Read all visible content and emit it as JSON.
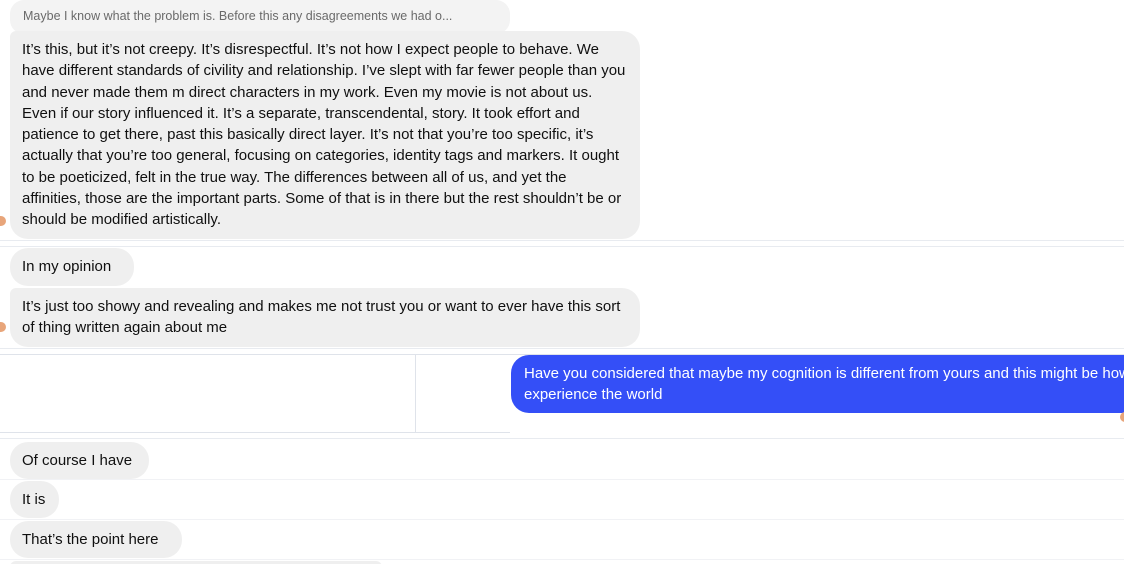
{
  "messages": {
    "reply_preview": "Maybe I know what the problem is. Before this any disagreements we had o...",
    "long_message": "It’s this, but it’s not creepy. It’s disrespectful. It’s not how I expect people to behave. We have different standards of civility and relationship. I’ve slept with far fewer people than you and never made them m direct characters in my work. Even my movie is not about us. Even if our story influenced it. It’s a separate, transcendental, story. It took effort and patience to get there, past this basically direct layer. It’s not that you’re too specific, it’s actually that you’re too general, focusing on categories, identity tags and markers. It ought to be poeticized, felt in the true way. The differences between all of us, and yet the affinities, those are the important parts. Some of that is in there but the rest shouldn’t be or should be modified artistically.",
    "opinion": "In my opinion",
    "too_showy": "It’s just too showy and revealing and makes me not trust you or want to ever have this sort of thing written again about me",
    "outgoing": "Have you considered that maybe my cognition is different from yours and this might be how I experience the world",
    "of_course": "Of course I have",
    "it_is": "It is",
    "point": "That’s the point here"
  },
  "colors": {
    "incoming_bubble": "#efefef",
    "outgoing_bubble": "#344ff7",
    "avatar_accent": "#e8a57a"
  }
}
